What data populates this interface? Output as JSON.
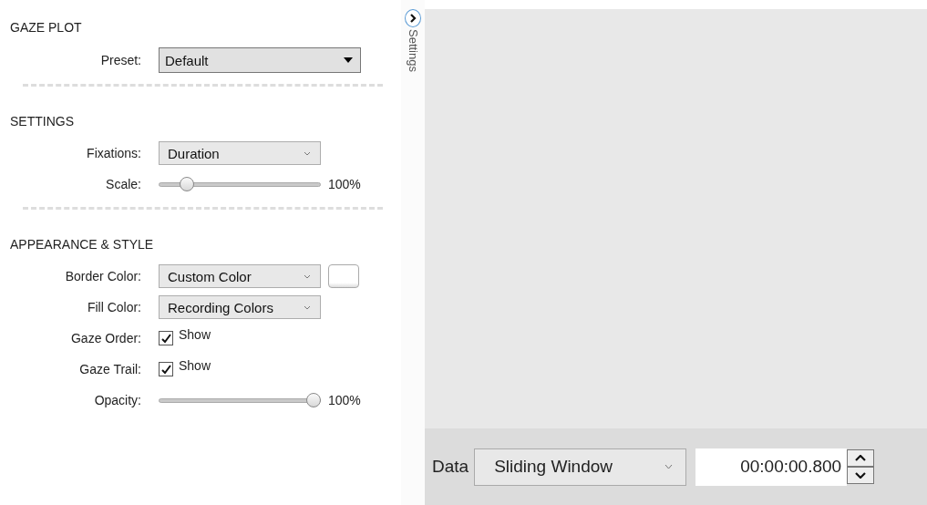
{
  "sections": [
    {
      "title": "GAZE PLOT",
      "rows": [
        {
          "kind": "preset",
          "label": "Preset:",
          "value": "Default"
        }
      ]
    },
    {
      "title": "SETTINGS",
      "rows": [
        {
          "kind": "select",
          "label": "Fixations:",
          "value": "Duration"
        },
        {
          "kind": "slider",
          "label": "Scale:",
          "level": 0.14,
          "reading": "100%"
        }
      ]
    },
    {
      "title": "APPEARANCE & STYLE",
      "rows": [
        {
          "kind": "color",
          "label": "Border Color:",
          "value": "Custom Color"
        },
        {
          "kind": "select",
          "label": "Fill Color:",
          "value": "Recording Colors"
        },
        {
          "kind": "checkbox",
          "label": "Gaze Order:",
          "checked": true,
          "text": "Show"
        },
        {
          "kind": "checkbox",
          "label": "Gaze Trail:",
          "checked": true,
          "text": "Show"
        },
        {
          "kind": "slider",
          "label": "Opacity:",
          "level": 1,
          "reading": "100%"
        }
      ]
    }
  ],
  "side_tab": {
    "label": "Settings"
  },
  "toolbar": {
    "label": "Data",
    "mode": "Sliding Window",
    "time": "00:00:00.800"
  }
}
